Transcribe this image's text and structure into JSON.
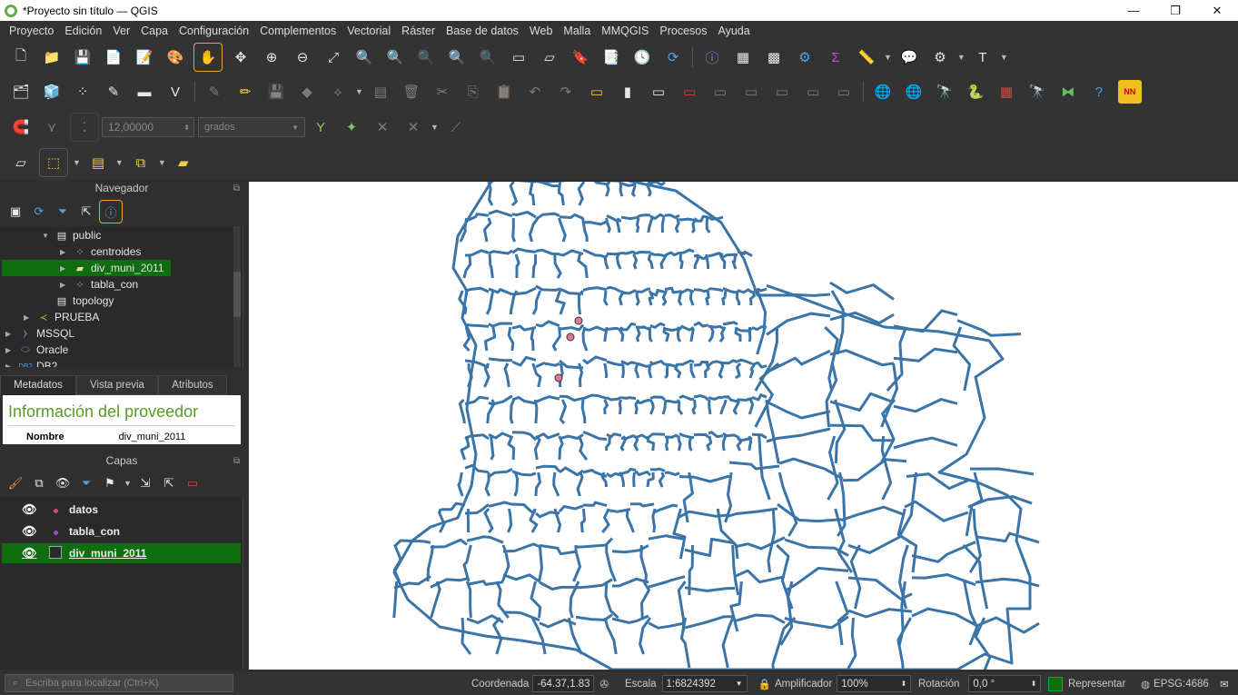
{
  "window": {
    "title": "*Proyecto sin título — QGIS",
    "minimize": "—",
    "restore": "❐",
    "close": "✕"
  },
  "menu": [
    "Proyecto",
    "Edición",
    "Ver",
    "Capa",
    "Configuración",
    "Complementos",
    "Vectorial",
    "Ráster",
    "Base de datos",
    "Web",
    "Malla",
    "MMQGIS",
    "Procesos",
    "Ayuda"
  ],
  "snapping": {
    "tolerance_value": "12,00000",
    "unit": "grados"
  },
  "navigator": {
    "title": "Navegador",
    "tree": [
      {
        "label": "public",
        "icon": "database-icon",
        "expanded": true
      },
      {
        "label": "centroides",
        "icon": "point-layer-icon"
      },
      {
        "label": "div_muni_2011",
        "icon": "polygon-layer-icon",
        "selected": true
      },
      {
        "label": "tabla_con",
        "icon": "point-layer-icon"
      },
      {
        "label": "topology",
        "icon": "database-icon"
      },
      {
        "label": "PRUEBA",
        "icon": "postgis-connection-icon"
      },
      {
        "label": "MSSQL",
        "icon": "mssql-icon"
      },
      {
        "label": "Oracle",
        "icon": "oracle-icon"
      },
      {
        "label": "DB2",
        "icon": "db2-icon"
      }
    ]
  },
  "metadata": {
    "tabs": [
      "Metadatos",
      "Vista previa",
      "Atributos"
    ],
    "active_tab": "Metadatos",
    "heading": "Información del proveedor",
    "row_label": "Nombre",
    "row_value": "div_muni_2011"
  },
  "layers": {
    "title": "Capas",
    "items": [
      {
        "name": "datos",
        "visible": true,
        "symbol": "point",
        "color": "#c8507a"
      },
      {
        "name": "tabla_con",
        "visible": true,
        "symbol": "point",
        "color": "#9b50c8"
      },
      {
        "name": "div_muni_2011",
        "visible": true,
        "symbol": "polygon",
        "selected": true
      }
    ]
  },
  "map": {
    "boundary_color": "#3b75a8",
    "point_color": "#e07a94"
  },
  "status": {
    "locator_placeholder": "Escriba para localizar (Ctrl+K)",
    "coord_label": "Coordenada",
    "coord_value": "-64.37,1.83",
    "scale_label": "Escala",
    "scale_value": "1:6824392",
    "magnifier_label": "Amplificador",
    "magnifier_value": "100%",
    "rotation_label": "Rotación",
    "rotation_value": "0,0 °",
    "render_label": "Representar",
    "crs": "EPSG:4686"
  }
}
